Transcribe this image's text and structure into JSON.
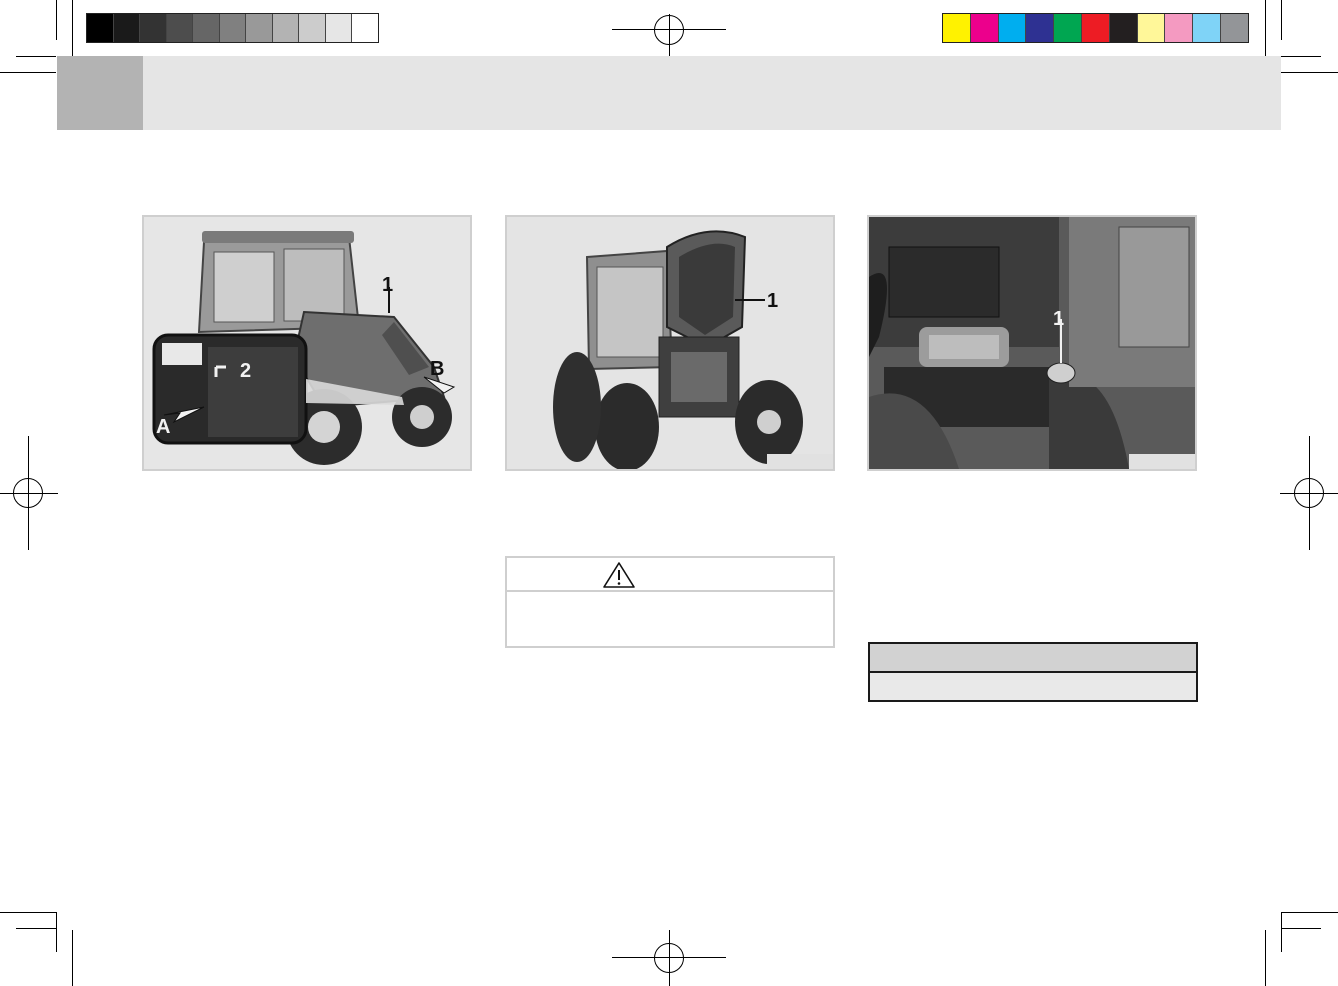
{
  "print_marks": {
    "grayscale_swatches": [
      "#000000",
      "#1a1a1a",
      "#333333",
      "#4d4d4d",
      "#666666",
      "#808080",
      "#999999",
      "#b3b3b3",
      "#cccccc",
      "#e6e6e6",
      "#ffffff"
    ],
    "color_swatches": [
      "#fff200",
      "#ec008c",
      "#00aeef",
      "#2e3192",
      "#00a651",
      "#ed1c24",
      "#231f20",
      "#fff799",
      "#f49ac1",
      "#7fd3f7",
      "#939598"
    ]
  },
  "figures": [
    {
      "callouts": [
        "1",
        "2",
        "A",
        "B"
      ]
    },
    {
      "callouts": [
        "1"
      ]
    },
    {
      "callouts": [
        "1"
      ]
    }
  ],
  "warning": {
    "icon": "warning-triangle-icon"
  }
}
